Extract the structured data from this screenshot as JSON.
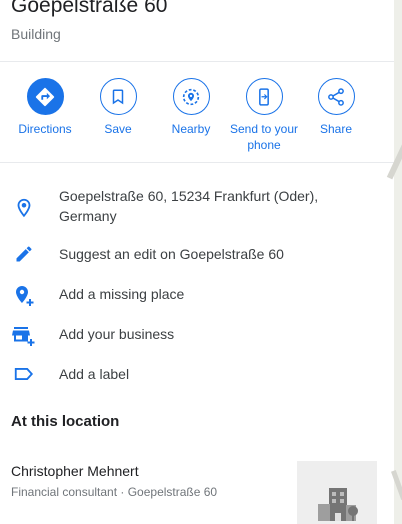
{
  "header": {
    "title": "Goepelstraße 60",
    "category": "Building"
  },
  "actions": [
    {
      "label": "Directions",
      "icon": "directions-icon"
    },
    {
      "label": "Save",
      "icon": "bookmark-icon"
    },
    {
      "label": "Nearby",
      "icon": "nearby-icon"
    },
    {
      "label": "Send to your phone",
      "icon": "phone-icon"
    },
    {
      "label": "Share",
      "icon": "share-icon"
    }
  ],
  "info": {
    "address": "Goepelstraße 60, 15234 Frankfurt (Oder), Germany",
    "suggest_edit": "Suggest an edit on Goepelstraße 60",
    "add_missing_place": "Add a missing place",
    "add_business": "Add your business",
    "add_label": "Add a label"
  },
  "at_location": {
    "title": "At this location",
    "places": [
      {
        "name": "Christopher Mehnert",
        "subtitle": "Financial consultant · Goepelstraße 60"
      }
    ]
  },
  "colors": {
    "accent": "#1a73e8",
    "text": "#202124",
    "secondary_text": "#70757a"
  }
}
